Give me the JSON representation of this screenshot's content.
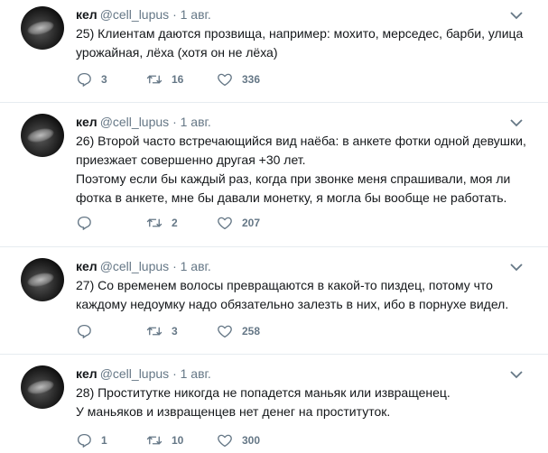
{
  "tweets": [
    {
      "name": "кел",
      "handle": "@cell_lupus",
      "separator": "·",
      "date": "1 авг.",
      "lines": [
        "25) Клиентам даются прозвища, например: мохито, мерседес, барби, улица урожайная, лёха (хотя он не лёха)"
      ],
      "replies": "3",
      "retweets": "16",
      "likes": "336"
    },
    {
      "name": "кел",
      "handle": "@cell_lupus",
      "separator": "·",
      "date": "1 авг.",
      "lines": [
        "26) Второй часто встречающийся вид наёба: в анкете фотки одной девушки, приезжает совершенно другая +30 лет.",
        "Поэтому если бы каждый раз, когда при звонке меня спрашивали, моя ли фотка в анкете, мне бы давали монетку, я могла бы вообще не работать."
      ],
      "replies": "",
      "retweets": "2",
      "likes": "207"
    },
    {
      "name": "кел",
      "handle": "@cell_lupus",
      "separator": "·",
      "date": "1 авг.",
      "lines": [
        "27) Со временем волосы превращаются в какой-то пиздец, потому что каждому недоумку надо обязательно залезть в них, ибо в порнухе видел."
      ],
      "replies": "",
      "retweets": "3",
      "likes": "258"
    },
    {
      "name": "кел",
      "handle": "@cell_lupus",
      "separator": "·",
      "date": "1 авг.",
      "lines": [
        "28) Проститутке никогда не попадется маньяк или извращенец.",
        "У маньяков и извращенцев нет денег на проституток."
      ],
      "replies": "1",
      "retweets": "10",
      "likes": "300"
    }
  ],
  "icons": {
    "reply": "reply-icon",
    "retweet": "retweet-icon",
    "like": "heart-icon",
    "caret": "chevron-down-icon"
  },
  "colors": {
    "icon": "#657786",
    "text": "#14171a",
    "secondary": "#657786",
    "divider": "#e6ecf0"
  }
}
